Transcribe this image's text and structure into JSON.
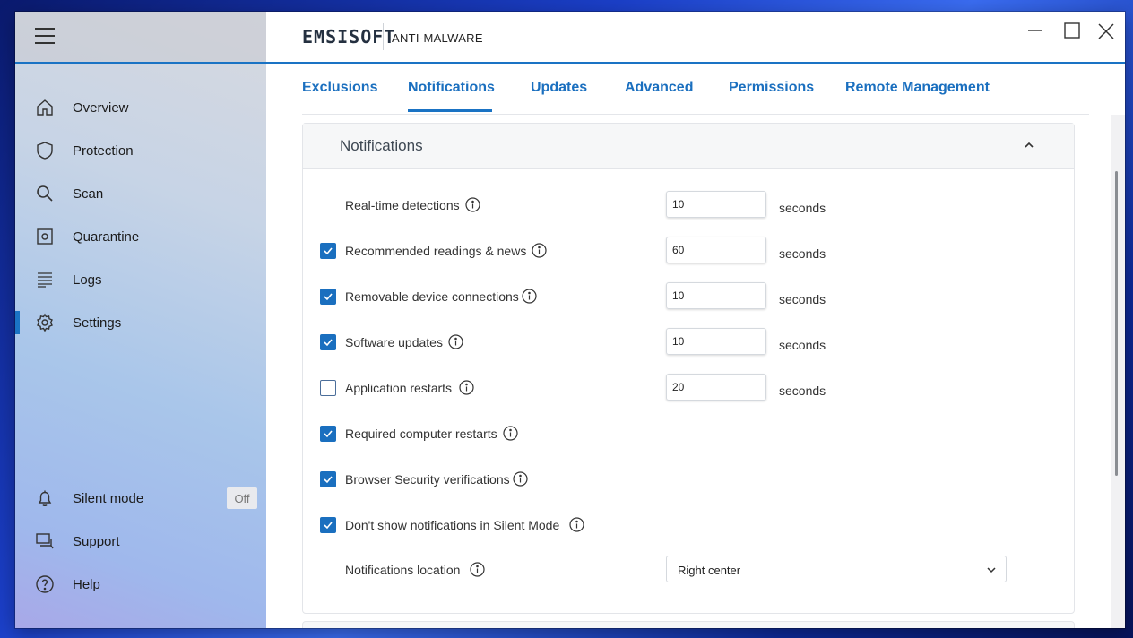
{
  "app": {
    "brand": "EMSISOFT",
    "product": "ANTI-MALWARE"
  },
  "sidebar": {
    "items": [
      {
        "label": "Overview",
        "icon": "home-icon"
      },
      {
        "label": "Protection",
        "icon": "shield-icon"
      },
      {
        "label": "Scan",
        "icon": "search-icon"
      },
      {
        "label": "Quarantine",
        "icon": "quarantine-icon"
      },
      {
        "label": "Logs",
        "icon": "list-icon"
      },
      {
        "label": "Settings",
        "icon": "gear-icon",
        "active": true
      }
    ],
    "bottom": [
      {
        "label": "Silent mode",
        "icon": "bell-icon",
        "badge": "Off"
      },
      {
        "label": "Support",
        "icon": "chat-icon"
      },
      {
        "label": "Help",
        "icon": "help-icon"
      }
    ]
  },
  "tabs": [
    {
      "label": "Exclusions"
    },
    {
      "label": "Notifications",
      "active": true
    },
    {
      "label": "Updates"
    },
    {
      "label": "Advanced"
    },
    {
      "label": "Permissions"
    },
    {
      "label": "Remote Management"
    }
  ],
  "section": {
    "title": "Notifications",
    "rows": [
      {
        "label": "Real-time detections",
        "checkbox": null,
        "value": "10",
        "unit": "seconds"
      },
      {
        "label": "Recommended readings & news",
        "checkbox": true,
        "value": "60",
        "unit": "seconds"
      },
      {
        "label": "Removable device connections",
        "checkbox": true,
        "value": "10",
        "unit": "seconds"
      },
      {
        "label": "Software updates",
        "checkbox": true,
        "value": "10",
        "unit": "seconds"
      },
      {
        "label": "Application restarts",
        "checkbox": false,
        "value": "20",
        "unit": "seconds"
      },
      {
        "label": "Required computer restarts",
        "checkbox": true
      },
      {
        "label": "Browser Security verifications",
        "checkbox": true
      },
      {
        "label": "Don't show notifications in Silent Mode",
        "checkbox": true
      }
    ],
    "location": {
      "label": "Notifications location",
      "value": "Right center"
    }
  },
  "colors": {
    "accent": "#1a73c4",
    "tab_text": "#1a6fbf",
    "checkbox": "#1a6fbf"
  }
}
